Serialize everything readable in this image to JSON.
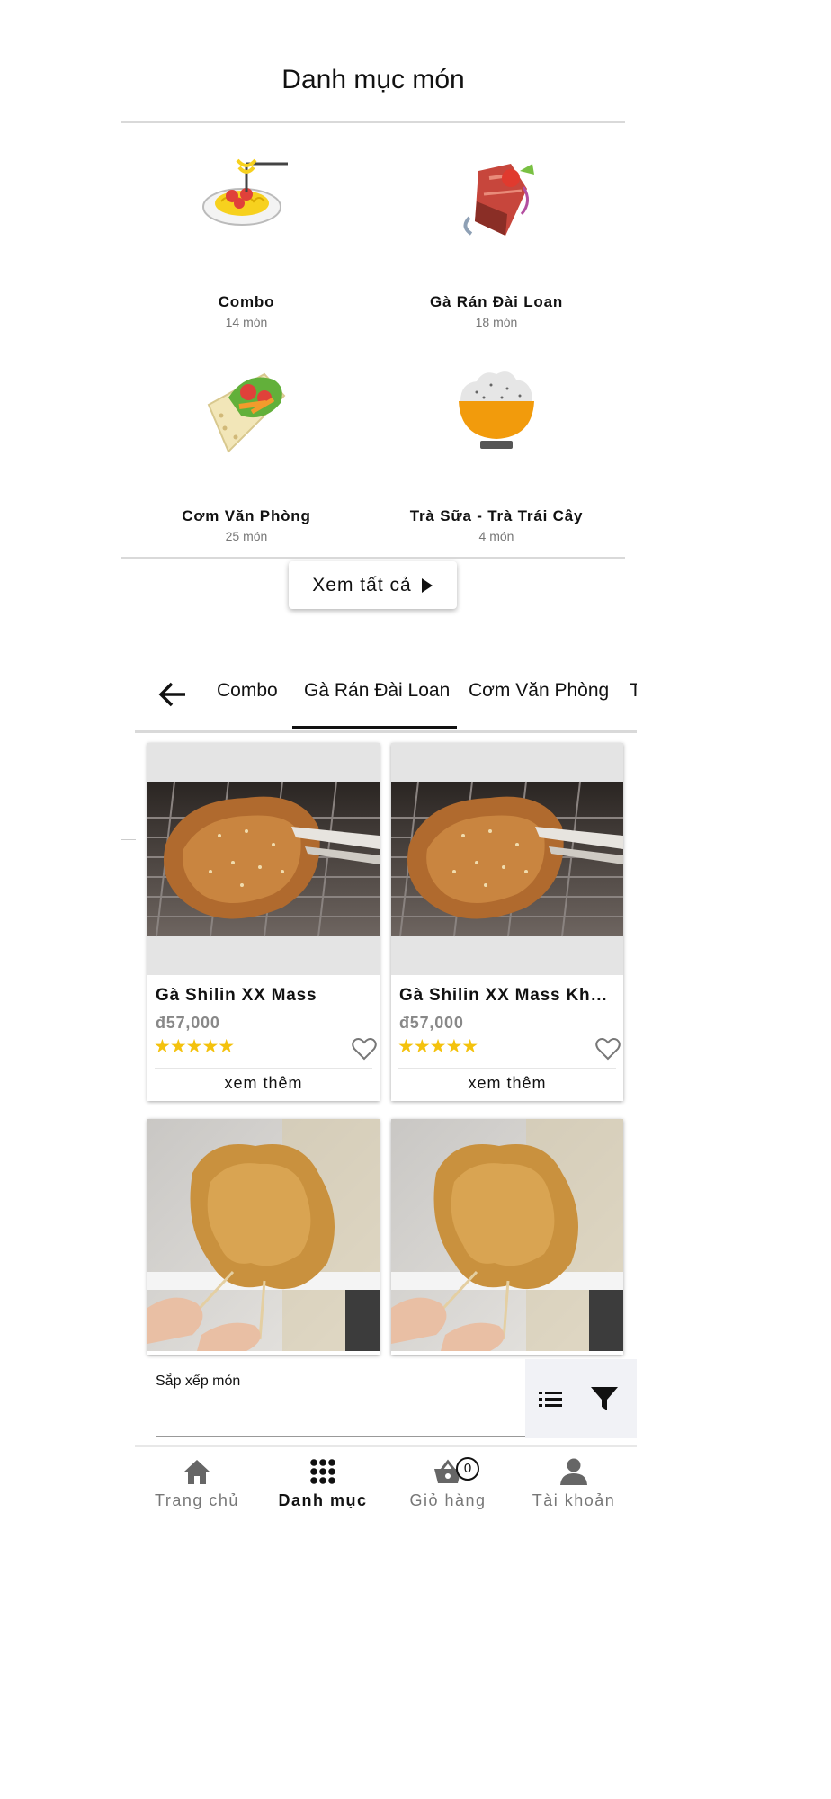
{
  "category_section": {
    "title": "Danh mục món",
    "items": [
      {
        "name": "Combo",
        "count": "14 món",
        "icon": "spaghetti-icon"
      },
      {
        "name": "Gà Rán Đài Loan",
        "count": "18 món",
        "icon": "meat-skewer-icon"
      },
      {
        "name": "Cơm Văn Phòng",
        "count": "25 món",
        "icon": "burrito-icon"
      },
      {
        "name": "Trà Sữa - Trà Trái Cây",
        "count": "4 món",
        "icon": "rice-bowl-icon"
      }
    ],
    "see_all_label": "Xem tất cả"
  },
  "tabs": {
    "items": [
      "Combo",
      "Gà Rán Đài Loan",
      "Cơm Văn Phòng",
      "Trà Sữa - Trà Trái Cây"
    ],
    "active_index": 1
  },
  "products": [
    {
      "name": "Gà Shilin XX Mass",
      "price": "đ57,000",
      "rating": 5,
      "stars": "★★★★★",
      "more_label": "xem thêm",
      "image": "fried-chicken-on-grill-photo"
    },
    {
      "name": "Gà Shilin XX Mass Không Cay",
      "price": "đ57,000",
      "rating": 5,
      "stars": "★★★★★",
      "more_label": "xem thêm",
      "image": "fried-chicken-on-grill-photo"
    },
    {
      "image": "fried-chicken-on-stick-photo"
    },
    {
      "image": "fried-chicken-on-stick-photo"
    }
  ],
  "sort_bar": {
    "label": "Sắp xếp món",
    "list_icon": "list-icon",
    "filter_icon": "filter-icon"
  },
  "bottom_nav": {
    "items": [
      {
        "label": "Trang chủ",
        "icon": "home-icon"
      },
      {
        "label": "Danh mục",
        "icon": "grid-icon"
      },
      {
        "label": "Giỏ hàng",
        "icon": "basket-icon"
      },
      {
        "label": "Tài khoản",
        "icon": "person-icon"
      }
    ],
    "active_index": 1,
    "cart_count": "0"
  },
  "colors": {
    "accent": "#111111",
    "star": "#f4c20d",
    "muted": "#777777",
    "divider": "#d9d9d9"
  }
}
